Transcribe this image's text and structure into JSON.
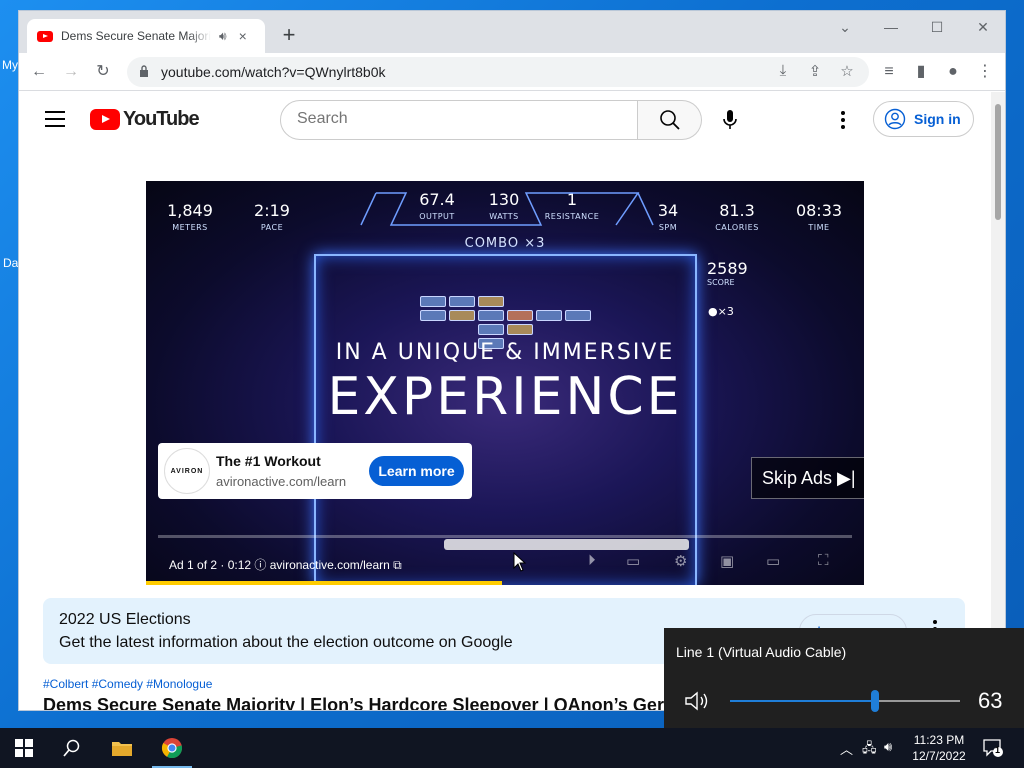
{
  "desktop": {
    "labels": [
      "My",
      "Da"
    ]
  },
  "browser": {
    "tab": {
      "title": "Dems Secure Senate Majority | Elon's Hardcore Sleepover",
      "close": "×"
    },
    "new_tab": "+",
    "url": "youtube.com/watch?v=QWnylrt8b0k"
  },
  "youtube": {
    "logo_text": "YouTube",
    "search": {
      "placeholder": "Search",
      "value": ""
    },
    "signin_label": "Sign in"
  },
  "player": {
    "stats": [
      {
        "value": "1,849",
        "label": "METERS"
      },
      {
        "value": "2:19",
        "label": "PACE"
      },
      {
        "value": "67.4",
        "label": "OUTPUT"
      },
      {
        "value": "130",
        "label": "WATTS"
      },
      {
        "value": "1",
        "label": "RESISTANCE"
      },
      {
        "value": "34",
        "label": "SPM"
      },
      {
        "value": "81.3",
        "label": "CALORIES"
      },
      {
        "value": "08:33",
        "label": "TIME"
      }
    ],
    "combo": "COMBO ×3",
    "score": {
      "value": "2589",
      "label": "SCORE"
    },
    "balls": "●×3",
    "headline1": "IN A UNIQUE & IMMERSIVE",
    "headline2": "EXPERIENCE",
    "ad": {
      "logo": "AVIRON",
      "title": "The #1 Workout",
      "domain": "avironactive.com/learn",
      "cta": "Learn more"
    },
    "skip_label": "Skip Ads ▶|",
    "ad_info": "Ad 1 of 2 · 0:12",
    "ad_info_domain": "avironactive.com/learn"
  },
  "info_panel": {
    "title": "2022 US Elections",
    "subtitle": "Get the latest information about the election outcome on Google",
    "learn_more": "Learn more"
  },
  "video": {
    "hashtags": "#Colbert #Comedy #Monologue",
    "title": "Dems Secure Senate Majority | Elon’s Hardcore Sleepover | QAnon’s Germa"
  },
  "volume": {
    "device": "Line 1 (Virtual Audio Cable)",
    "level": 63,
    "level_text": "63"
  },
  "taskbar": {
    "time": "11:23 PM",
    "date": "12/7/2022",
    "notification_count": "1"
  },
  "colors": {
    "youtube_red": "#ff0000",
    "link_blue": "#065fd4",
    "accent_blue": "#1f7ed8"
  }
}
